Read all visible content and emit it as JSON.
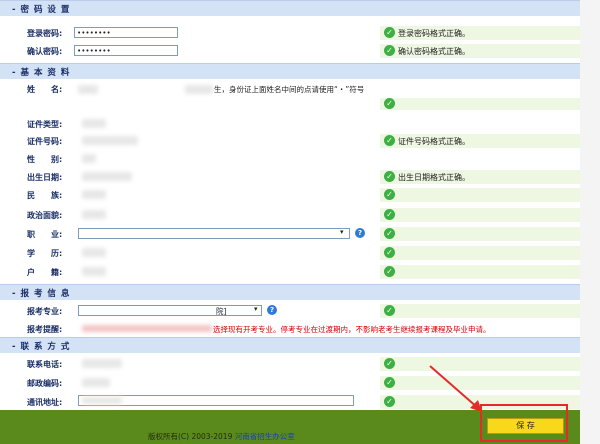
{
  "sections": {
    "password": "- 密 码 设 置",
    "basic": "- 基 本 资 料",
    "apply": "- 报 考 信 息",
    "contact": "- 联 系 方 式"
  },
  "password": {
    "login_label": "登录密码:",
    "login_value": "••••••••",
    "login_msg": "登录密码格式正确。",
    "confirm_label": "确认密码:",
    "confirm_value": "••••••••",
    "confirm_msg": "确认密码格式正确。"
  },
  "basic": {
    "name_label": "姓　　名:",
    "name_hint": "生，身份证上面姓名中间的点请使用“・”符号",
    "idtype_label": "证件类型:",
    "idno_label": "证件号码:",
    "idno_msg": "证件号码格式正确。",
    "gender_label": "性　　别:",
    "birth_label": "出生日期:",
    "birth_msg": "出生日期格式正确。",
    "ethnic_label": "民　　族:",
    "political_label": "政治面貌:",
    "job_label": "职　　业:",
    "edu_label": "学　　历:",
    "hukou_label": "户　　籍:"
  },
  "apply": {
    "major_label": "报考专业:",
    "major_select_tail": "院]",
    "remind_label": "报考提醒:",
    "remind_text": "选择现有开考专业。停考专业在过渡期内，不影响老考生继续报考课程及毕业申请。"
  },
  "contact": {
    "phone_label": "联系电话:",
    "zip_label": "邮政编码:",
    "addr_label": "通讯地址:"
  },
  "footer": {
    "copyright": "版权所有(C) 2003-2019",
    "org": "河南省招生办公室"
  },
  "save_label": "保 存",
  "colors": {
    "section_bg": "#d3e2f5",
    "ok_green": "#3cb043",
    "footer": "#5a8a1c",
    "save": "#f8d81a",
    "warn_red": "#d40000"
  }
}
